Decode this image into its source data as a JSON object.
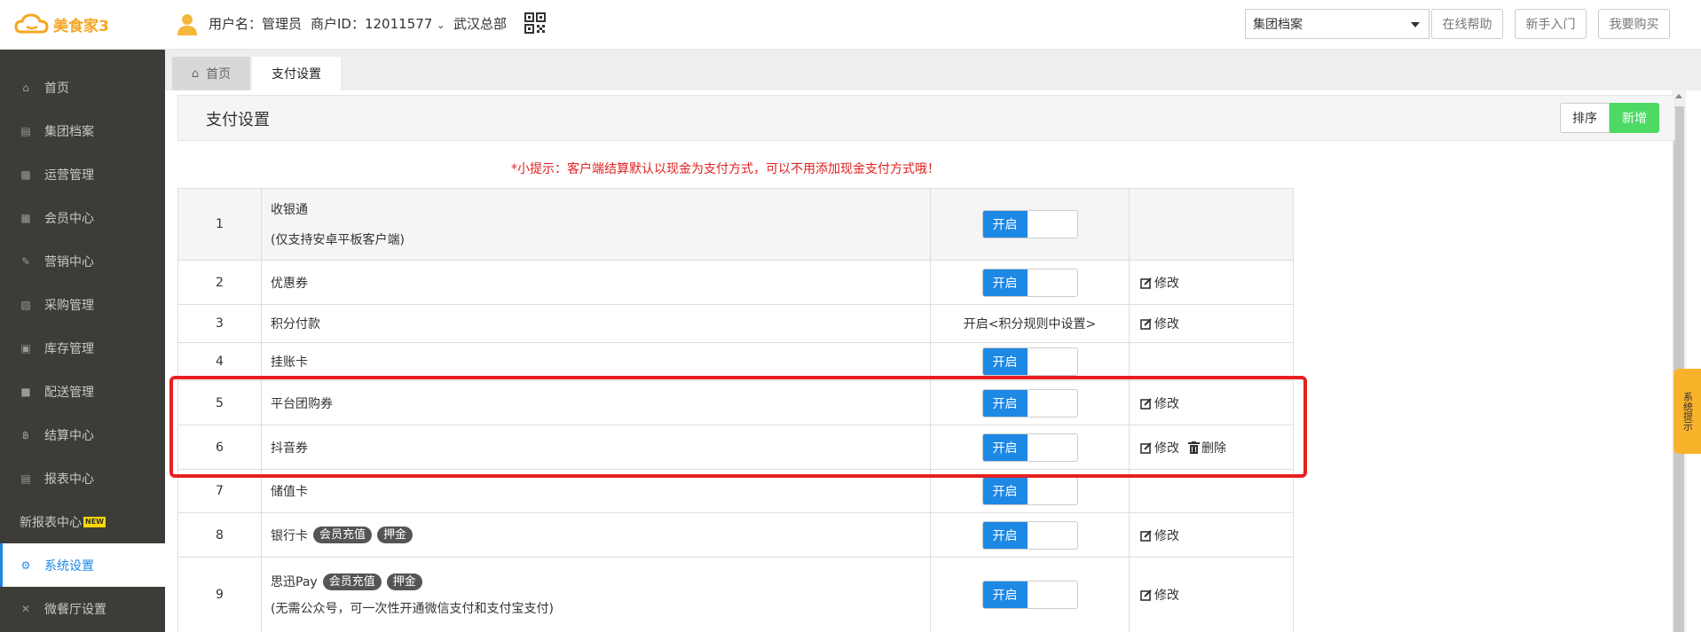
{
  "header": {
    "logo_text": "美食家3",
    "username_label": "用户名：管理员",
    "merchant_label": "商户ID：12011577",
    "store": "武汉总部",
    "select_value": "集团档案",
    "help_btn": "在线帮助",
    "newbie_btn": "新手入门",
    "buy_btn": "我要购买",
    "colors": {
      "brand": "#f5a623"
    }
  },
  "sidebar": {
    "items": [
      {
        "label": "首页",
        "icon": "home-icon"
      },
      {
        "label": "集团档案",
        "icon": "file-icon"
      },
      {
        "label": "运营管理",
        "icon": "bar-chart-icon"
      },
      {
        "label": "会员中心",
        "icon": "id-card-icon"
      },
      {
        "label": "营销中心",
        "icon": "edit-icon"
      },
      {
        "label": "采购管理",
        "icon": "book-icon"
      },
      {
        "label": "库存管理",
        "icon": "clipboard-icon"
      },
      {
        "label": "配送管理",
        "icon": "truck-icon"
      },
      {
        "label": "结算中心",
        "icon": "bitcoin-icon"
      },
      {
        "label": "报表中心",
        "icon": "report-icon"
      },
      {
        "label": "新报表中心",
        "icon": "",
        "badge": "NEW"
      },
      {
        "label": "系统设置",
        "icon": "gears-icon",
        "active": true
      },
      {
        "label": "微餐厅设置",
        "icon": "cutlery-icon"
      }
    ]
  },
  "tabs": {
    "home": "首页",
    "current": "支付设置"
  },
  "page": {
    "title": "支付设置",
    "sort_btn": "排序",
    "new_btn": "新增",
    "tip": "*小提示：客户端结算默认以现金为支付方式，可以不用添加现金支付方式哦！",
    "side_tip": "系统提示"
  },
  "table": {
    "rows": [
      {
        "num": "1",
        "name": "收银通",
        "sub": "(仅支持安卓平板客户端)",
        "status": "开启",
        "actions": []
      },
      {
        "num": "2",
        "name": "优惠券",
        "status": "开启",
        "actions": [
          "修改"
        ]
      },
      {
        "num": "3",
        "name": "积分付款",
        "status_text": "开启<积分规则中设置>",
        "actions": [
          "修改"
        ]
      },
      {
        "num": "4",
        "name": "挂账卡",
        "status": "开启",
        "actions": []
      },
      {
        "num": "5",
        "name": "平台团购券",
        "status": "开启",
        "actions": [
          "修改"
        ]
      },
      {
        "num": "6",
        "name": "抖音券",
        "status": "开启",
        "actions": [
          "修改",
          "删除"
        ]
      },
      {
        "num": "7",
        "name": "储值卡",
        "status": "开启",
        "actions": []
      },
      {
        "num": "8",
        "name": "银行卡",
        "tags": [
          "会员充值",
          "押金"
        ],
        "status": "开启",
        "actions": [
          "修改"
        ]
      },
      {
        "num": "9",
        "name": "思迅Pay",
        "tags": [
          "会员充值",
          "押金"
        ],
        "sub": "(无需公众号，可一次性开通微信支付和支付宝支付)",
        "status": "开启",
        "actions": [
          "修改"
        ]
      }
    ]
  }
}
